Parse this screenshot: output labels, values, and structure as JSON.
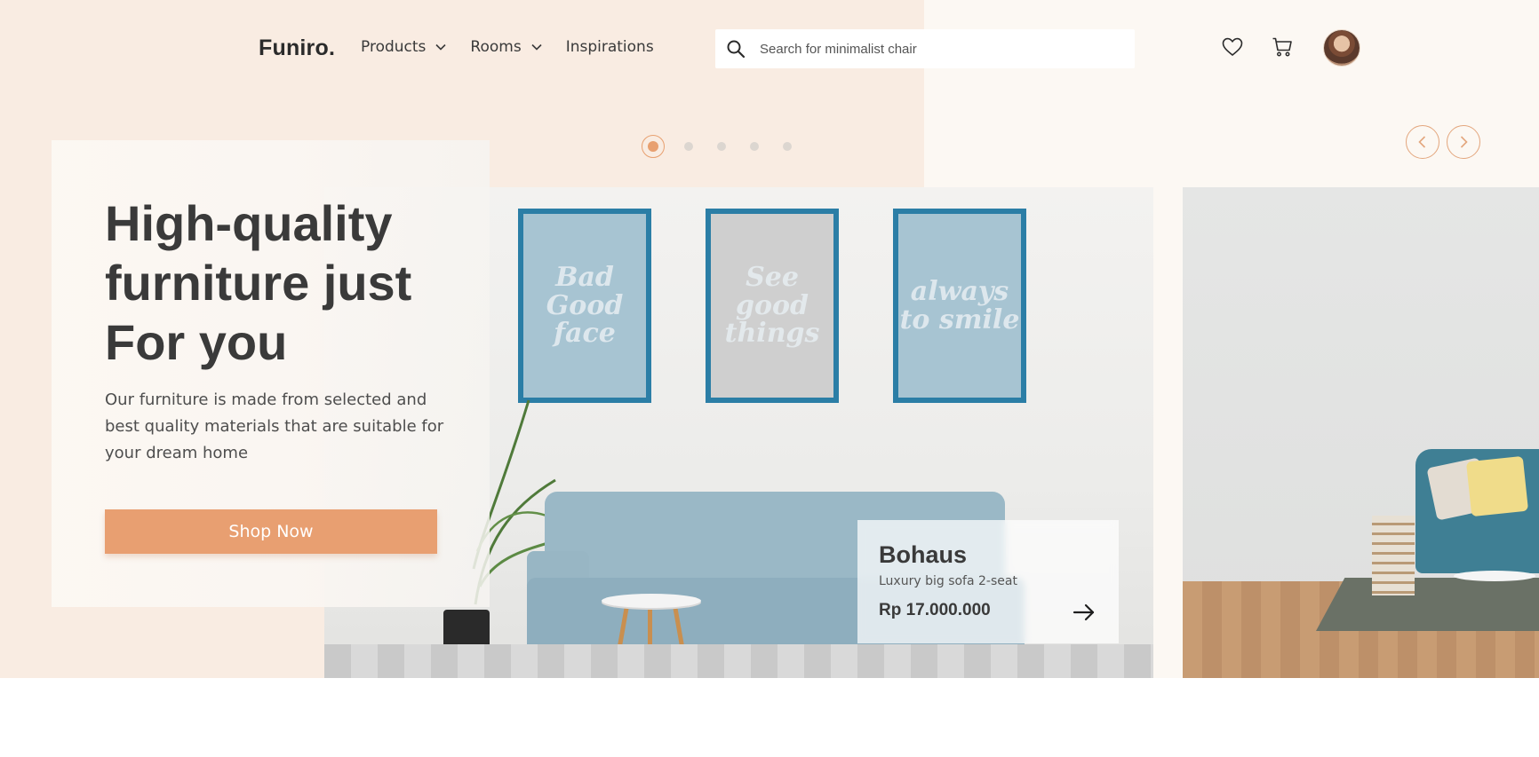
{
  "header": {
    "logo": "Funiro.",
    "nav": [
      {
        "label": "Products",
        "has_dropdown": true
      },
      {
        "label": "Rooms",
        "has_dropdown": true
      },
      {
        "label": "Inspirations",
        "has_dropdown": false
      }
    ],
    "search": {
      "placeholder": "Search for minimalist chair",
      "icon": "search-icon"
    },
    "icons": [
      "heart-icon",
      "cart-icon"
    ],
    "avatar": "user-avatar"
  },
  "carousel": {
    "dots_count": 5,
    "active_dot": 1,
    "prev_icon": "chevron-left-icon",
    "next_icon": "chevron-right-icon"
  },
  "hero": {
    "title": "High-quality furniture just For you",
    "subtitle": "Our furniture is made from selected and best quality materials that are suitable for your dream home",
    "cta_label": "Shop Now"
  },
  "product": {
    "name": "Bohaus",
    "description": "Luxury big sofa 2-seat",
    "price": "Rp 17.000.000",
    "arrow_icon": "arrow-right-icon"
  },
  "colors": {
    "accent": "#e89f71",
    "bg_peach": "#f9ece2",
    "bg_cream": "#fcf8f3",
    "text_dark": "#3a3a3a"
  }
}
